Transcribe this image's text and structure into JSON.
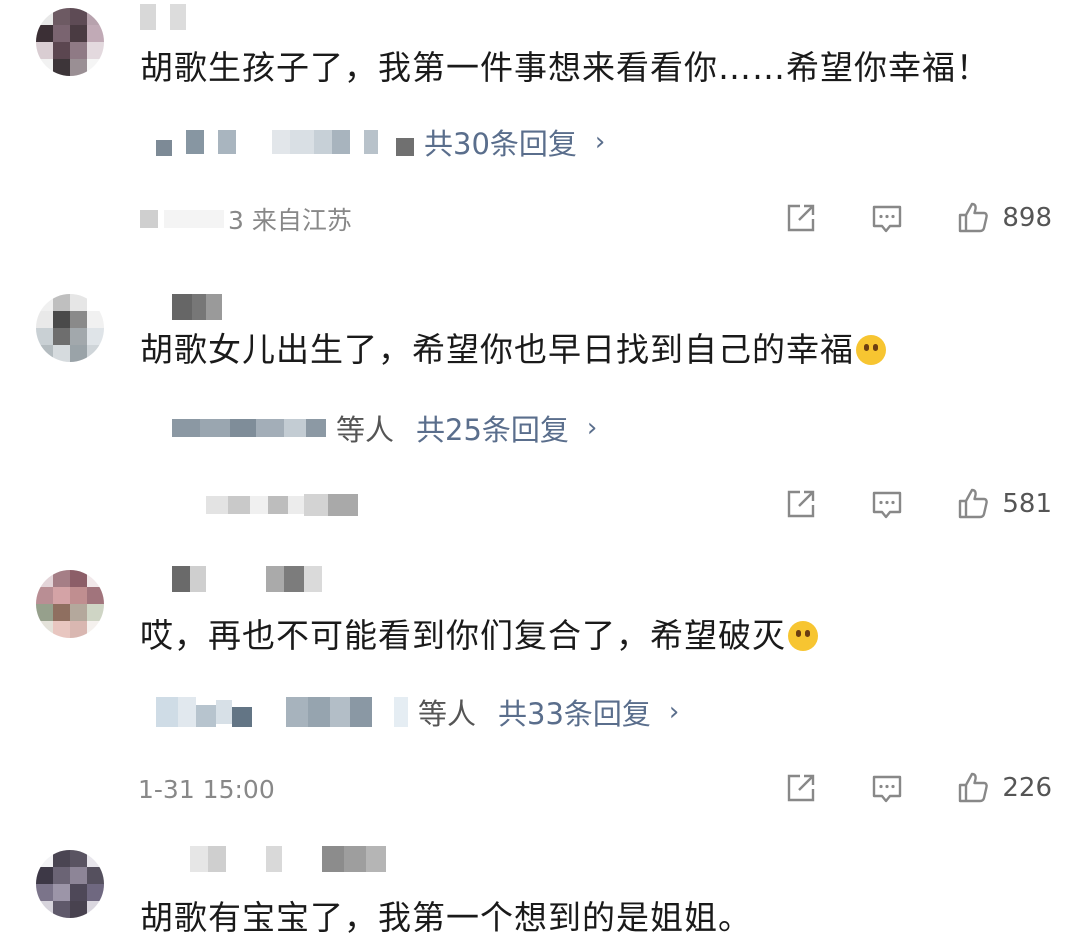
{
  "comments": [
    {
      "text": "胡歌生孩子了，我第一件事想来看看你……希望你幸福！",
      "emoji": "",
      "reply_prefix": "",
      "reply_count": "共30条回复",
      "meta": "3 来自江苏",
      "likes": "898"
    },
    {
      "text": "胡歌女儿出生了，希望你也早日找到自己的幸福",
      "emoji": "happy-tears-emoji",
      "reply_prefix": "等人",
      "reply_count": "共25条回复",
      "meta": "",
      "likes": "581"
    },
    {
      "text": "哎，再也不可能看到你们复合了，希望破灭",
      "emoji": "laughing-crying-emoji",
      "reply_prefix": "等人",
      "reply_count": "共33条回复",
      "meta": "1-31 15:00",
      "likes": "226"
    },
    {
      "text": "胡歌有宝宝了，我第一个想到的是姐姐。",
      "emoji": "",
      "reply_prefix": "",
      "reply_count": "",
      "meta": "",
      "likes": ""
    }
  ],
  "icons": {
    "share": "share-icon",
    "comment": "comment-icon",
    "like": "thumbs-up-icon",
    "chevron": "›"
  },
  "colors": {
    "link": "#5a6e8c",
    "text": "#1a1a1a",
    "meta": "#888888",
    "emoji": "#f7c531"
  }
}
